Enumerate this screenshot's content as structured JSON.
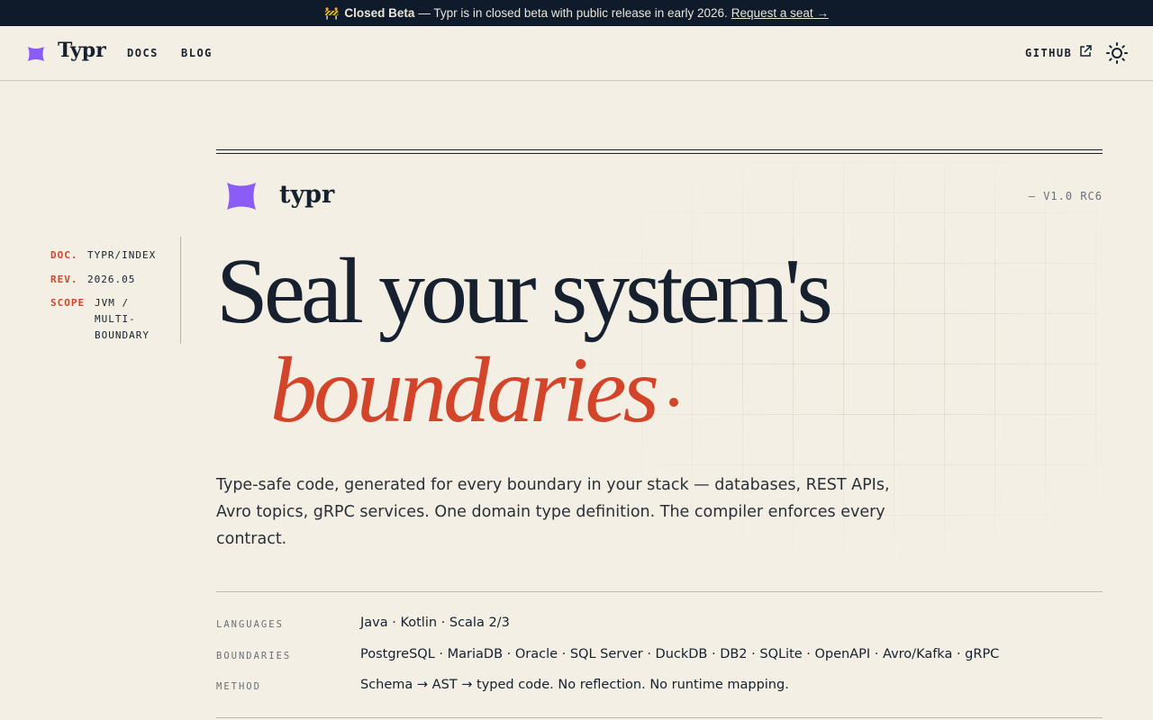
{
  "banner": {
    "icon": "construction-icon",
    "title": "Closed Beta",
    "message": "— Typr is in closed beta with public release in early 2026.",
    "link": "Request a seat →"
  },
  "nav": {
    "logo": "Typr",
    "links": [
      "DOCS",
      "BLOG"
    ],
    "github": "GITHUB"
  },
  "hero": {
    "brand": "typr",
    "version": "— V1.0 RC6",
    "meta": {
      "doc_key": "DOC.",
      "doc_val": "TYPR/INDEX",
      "rev_key": "REV.",
      "rev_val": "2026.05",
      "scope_key": "SCOPE",
      "scope_val_1": "JVM /",
      "scope_val_2": "MULTI-",
      "scope_val_3": "BOUNDARY"
    },
    "headline_1": "Seal your system's",
    "headline_2": "boundaries",
    "lede": "Type-safe code, generated for every boundary in your stack — databases, REST APIs, Avro topics, gRPC services. One domain type definition. The compiler enforces every contract."
  },
  "specs": [
    {
      "label": "LANGUAGES",
      "value": "Java · Kotlin · Scala 2/3"
    },
    {
      "label": "BOUNDARIES",
      "value": "PostgreSQL · MariaDB · Oracle · SQL Server · DuckDB · DB2 · SQLite · OpenAPI · Avro/Kafka · gRPC"
    },
    {
      "label": "METHOD",
      "value": "Schema → AST → typed code. No reflection. No runtime mapping."
    }
  ],
  "colors": {
    "accent": "#d2452a",
    "brand": "#8b5cf6",
    "ink": "#16202f",
    "paper": "#f3efe4"
  }
}
